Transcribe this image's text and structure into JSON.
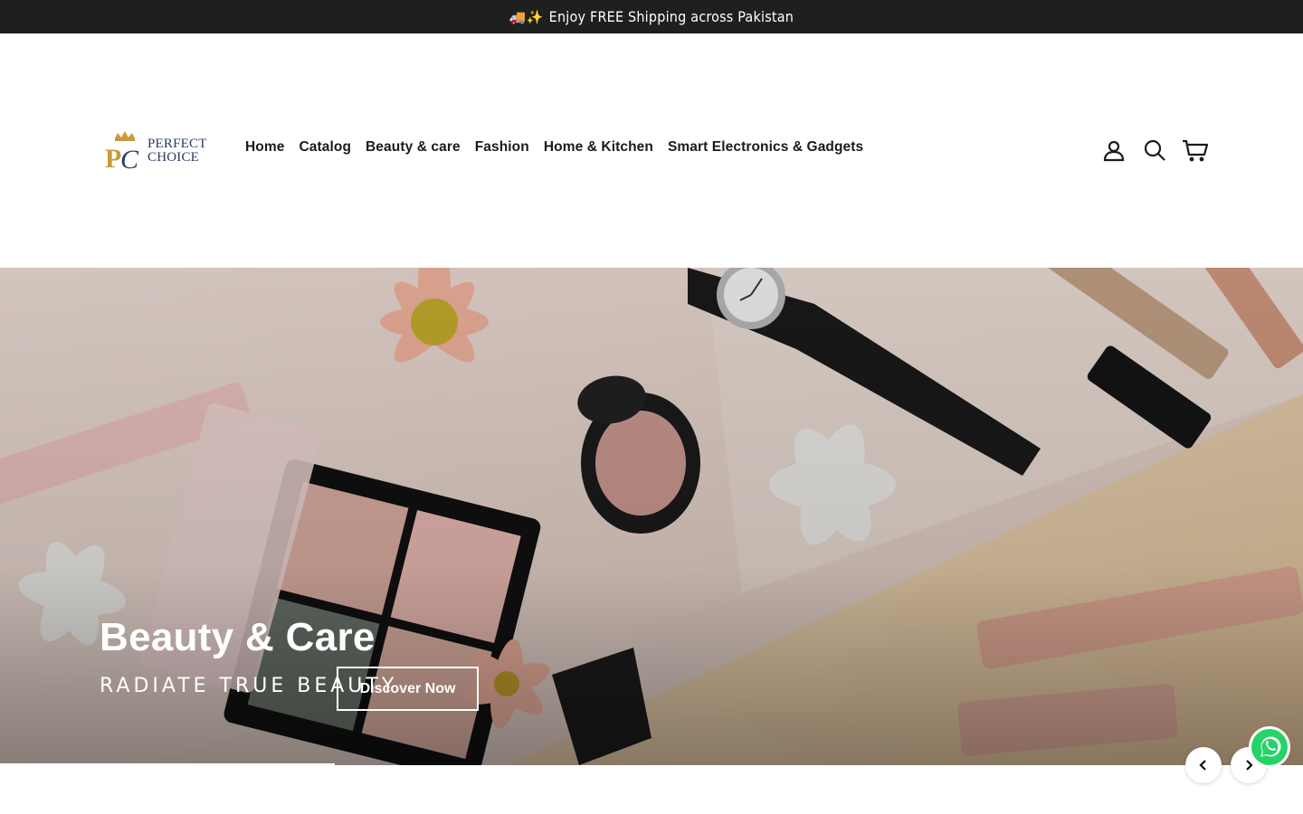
{
  "announcement": {
    "emoji": "🚚✨",
    "text": "Enjoy FREE Shipping across Pakistan"
  },
  "logo": {
    "line1": "PERFECT",
    "line2": "CHOICE",
    "mark": "PC"
  },
  "nav": {
    "items": [
      {
        "label": "Home"
      },
      {
        "label": "Catalog"
      },
      {
        "label": "Beauty & care"
      },
      {
        "label": "Fashion"
      },
      {
        "label": "Home & Kitchen"
      },
      {
        "label": "Smart Electronics & Gadgets"
      }
    ]
  },
  "header_icons": [
    "account-icon",
    "search-icon",
    "cart-icon"
  ],
  "hero": {
    "title": "Beauty & Care",
    "subtitle": "RADIATE TRUE BEAUTY",
    "button_label": "Discover Now"
  },
  "colors": {
    "announcement_bg": "#1e1f1f",
    "logo_navy": "#2a3b63",
    "logo_gold": "#c99a3b",
    "whatsapp_green": "#25d366"
  }
}
